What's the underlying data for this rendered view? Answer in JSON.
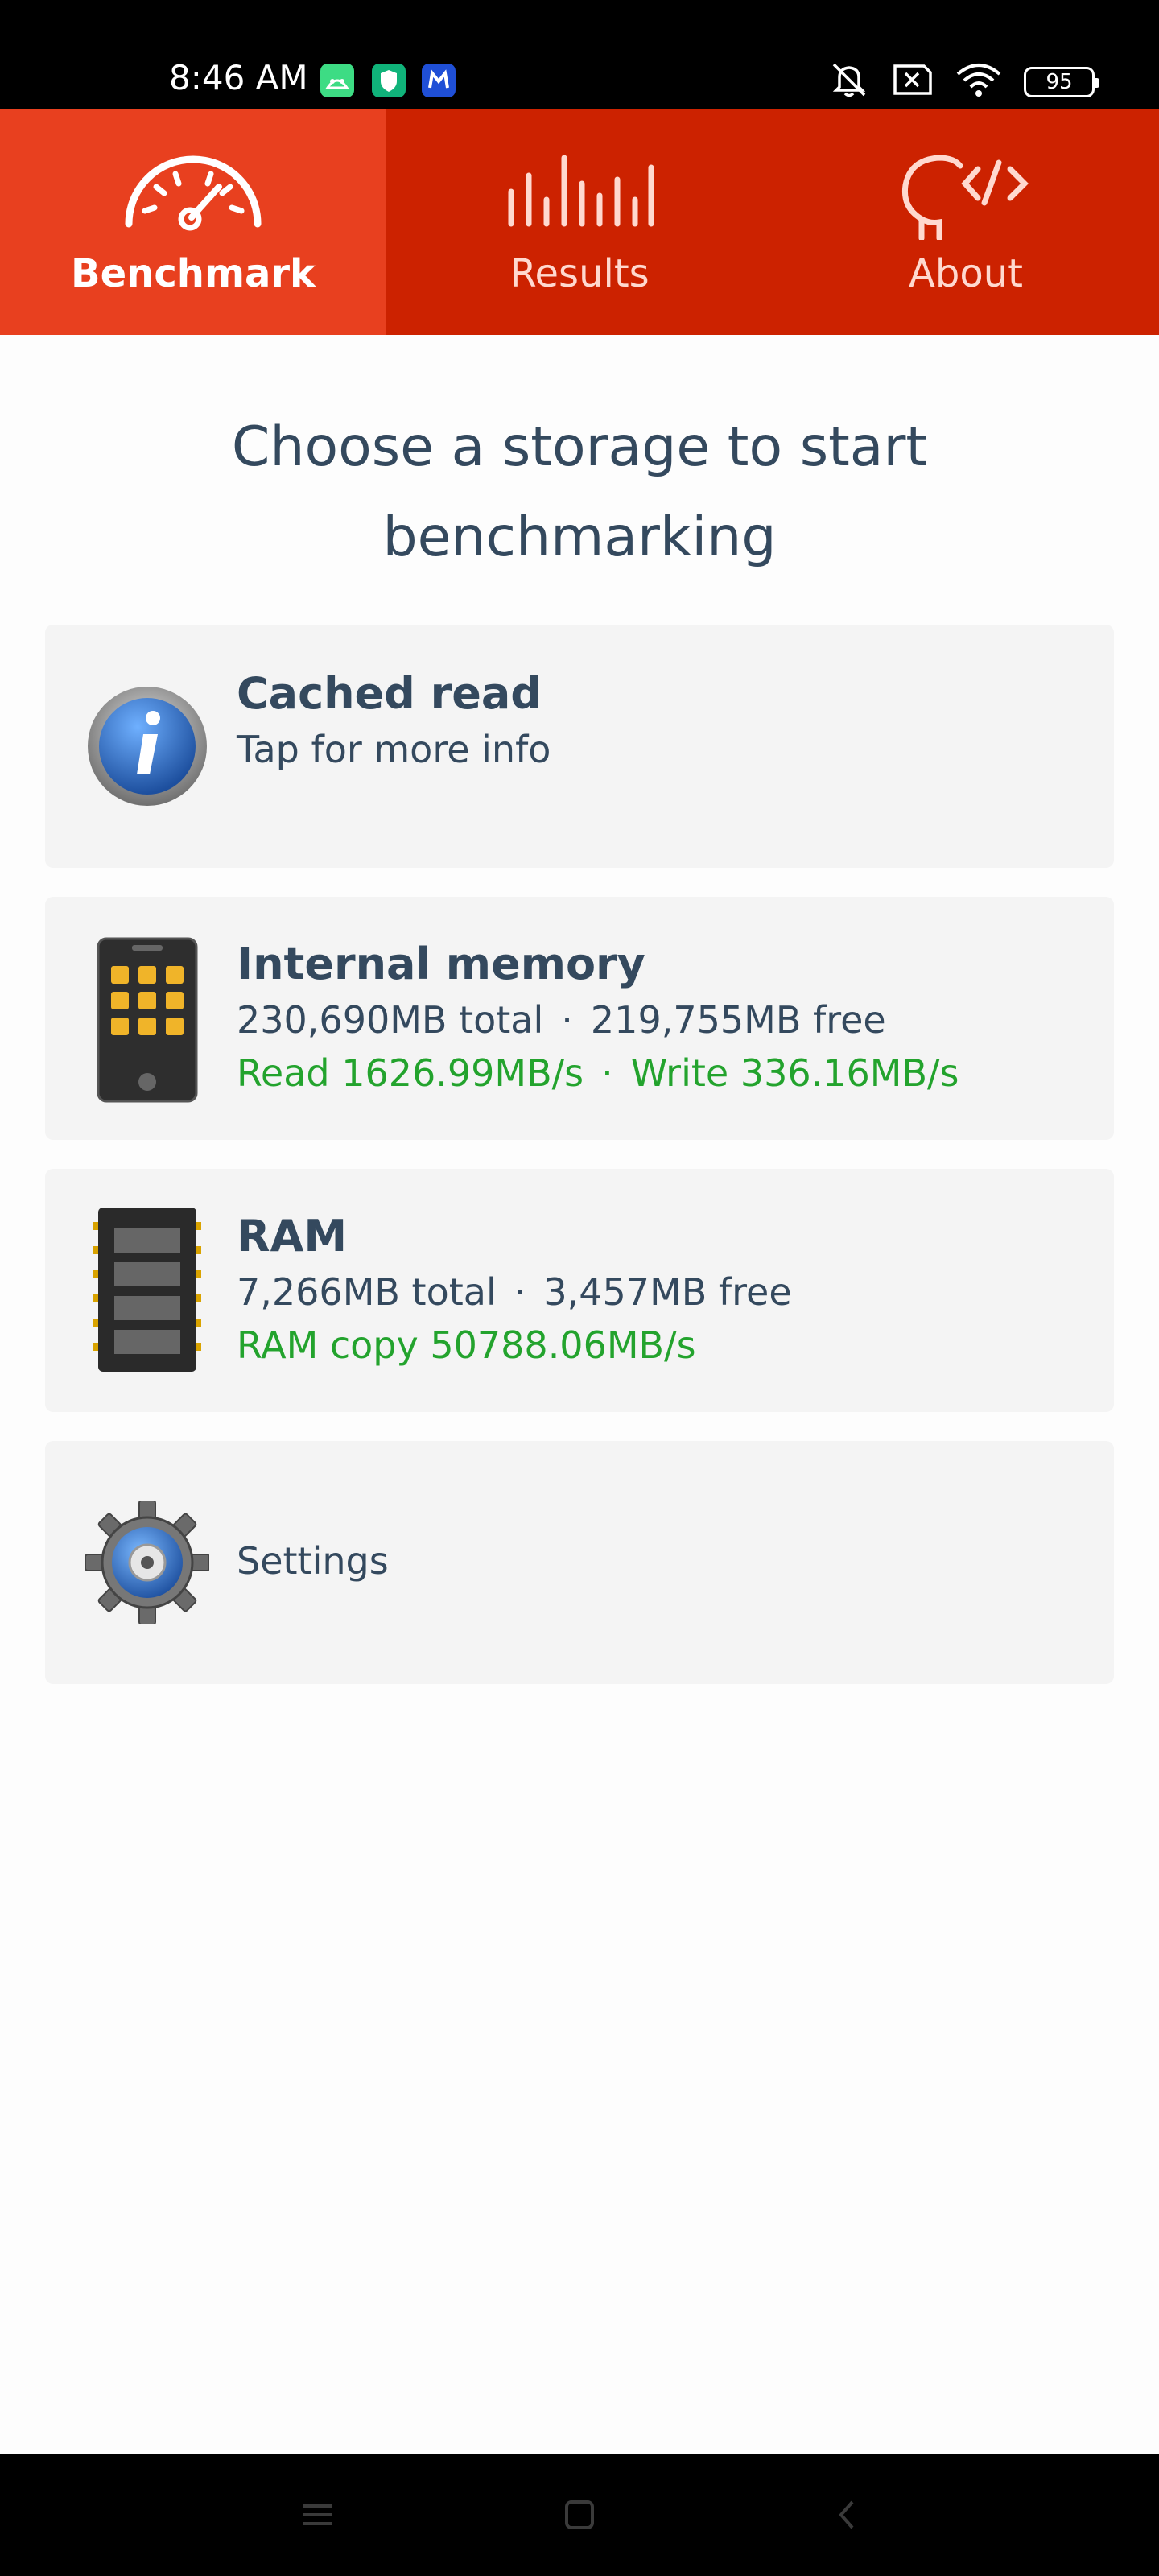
{
  "status_bar": {
    "time": "8:46 AM",
    "battery": "95",
    "icons": [
      "android-icon",
      "shield-app-icon",
      "m-app-icon",
      "mute-icon",
      "sim-off-icon",
      "wifi-icon",
      "battery-icon"
    ]
  },
  "tabs": [
    {
      "label": "Benchmark",
      "icon": "speedometer-icon",
      "active": true
    },
    {
      "label": "Results",
      "icon": "bars-icon",
      "active": false
    },
    {
      "label": "About",
      "icon": "head-code-icon",
      "active": false
    }
  ],
  "heading": {
    "line1": "Choose a storage to start",
    "line2": "benchmarking"
  },
  "cards": {
    "cached": {
      "title": "Cached read",
      "subtitle": "Tap for more info",
      "icon": "info-icon"
    },
    "internal": {
      "title": "Internal memory",
      "total": "230,690MB total",
      "free": "219,755MB free",
      "read": "Read 1626.99MB/s",
      "write": "Write 336.16MB/s",
      "separator": "·",
      "icon": "phone-icon"
    },
    "ram": {
      "title": "RAM",
      "total": "7,266MB total",
      "free": "3,457MB free",
      "copy": "RAM copy 50788.06MB/s",
      "separator": "·",
      "icon": "ram-chip-icon"
    },
    "settings": {
      "title": "Settings",
      "icon": "gear-icon"
    }
  },
  "colors": {
    "tab_bar": "#cc2200",
    "tab_active": "#e8401f",
    "text": "#34495e",
    "green": "#23a32d",
    "card": "#f4f4f4"
  }
}
